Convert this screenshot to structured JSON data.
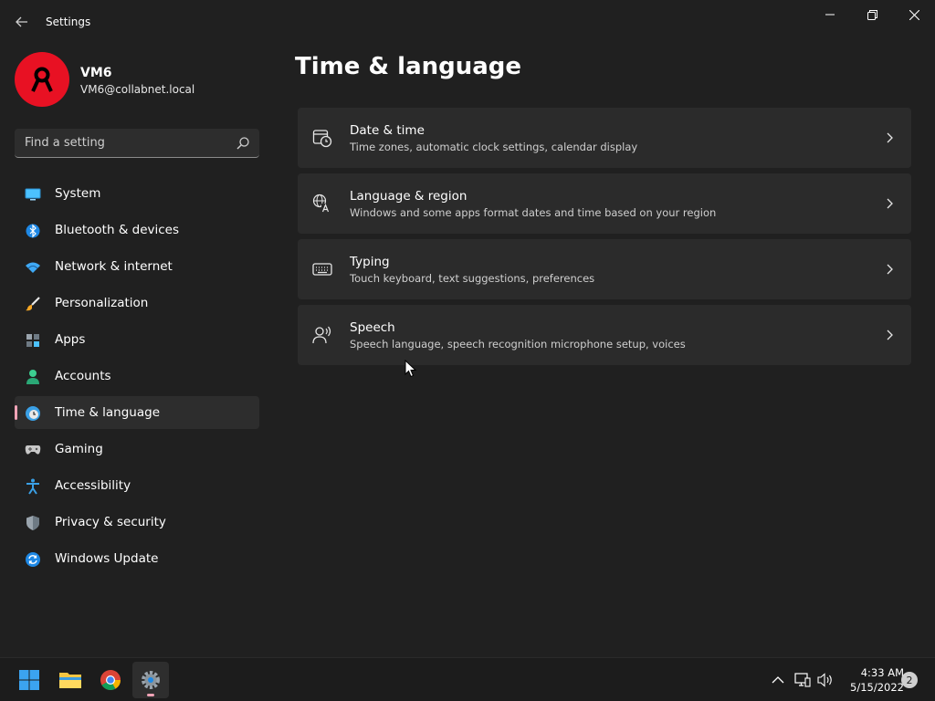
{
  "window": {
    "title": "Settings",
    "icons": {
      "back": "arrow-left-icon",
      "minimize": "minimize-icon",
      "maximize": "restore-icon",
      "close": "close-icon"
    }
  },
  "profile": {
    "name": "VM6",
    "email": "VM6@collabnet.local",
    "avatar_color": "#e81123"
  },
  "search": {
    "placeholder": "Find a setting",
    "value": ""
  },
  "sidebar": {
    "accent": "#f0a3b6",
    "items": [
      {
        "label": "System",
        "icon": "monitor-icon",
        "active": false
      },
      {
        "label": "Bluetooth & devices",
        "icon": "bluetooth-icon",
        "active": false
      },
      {
        "label": "Network & internet",
        "icon": "wifi-icon",
        "active": false
      },
      {
        "label": "Personalization",
        "icon": "brush-icon",
        "active": false
      },
      {
        "label": "Apps",
        "icon": "apps-icon",
        "active": false
      },
      {
        "label": "Accounts",
        "icon": "person-icon",
        "active": false
      },
      {
        "label": "Time & language",
        "icon": "globe-clock-icon",
        "active": true
      },
      {
        "label": "Gaming",
        "icon": "gamepad-icon",
        "active": false
      },
      {
        "label": "Accessibility",
        "icon": "accessibility-icon",
        "active": false
      },
      {
        "label": "Privacy & security",
        "icon": "shield-icon",
        "active": false
      },
      {
        "label": "Windows Update",
        "icon": "update-icon",
        "active": false
      }
    ]
  },
  "main": {
    "title": "Time & language",
    "cards": [
      {
        "title": "Date & time",
        "description": "Time zones, automatic clock settings, calendar display",
        "icon": "calendar-clock-icon"
      },
      {
        "title": "Language & region",
        "description": "Windows and some apps format dates and time based on your region",
        "icon": "language-icon"
      },
      {
        "title": "Typing",
        "description": "Touch keyboard, text suggestions, preferences",
        "icon": "keyboard-icon"
      },
      {
        "title": "Speech",
        "description": "Speech language, speech recognition microphone setup, voices",
        "icon": "speech-icon"
      }
    ]
  },
  "taskbar": {
    "apps": [
      {
        "name": "start-icon"
      },
      {
        "name": "file-explorer-icon"
      },
      {
        "name": "chrome-icon"
      },
      {
        "name": "settings-icon",
        "active": true
      }
    ],
    "tray": [
      "chevron-up-icon",
      "network-icon",
      "volume-icon"
    ],
    "time": "4:33 AM",
    "date": "5/15/2022",
    "notifications": "2"
  }
}
